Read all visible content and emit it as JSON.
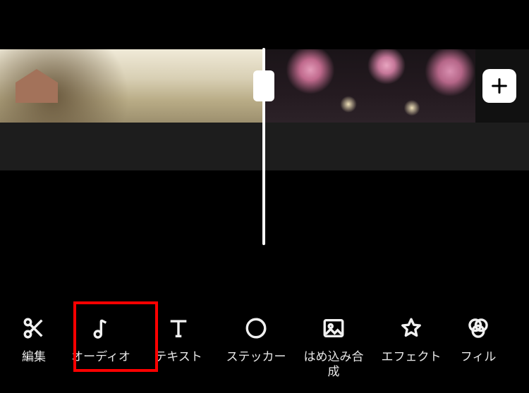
{
  "toolbar": {
    "items": [
      {
        "label": "編集"
      },
      {
        "label": "オーディオ"
      },
      {
        "label": "テキスト"
      },
      {
        "label": "ステッカー"
      },
      {
        "label": "はめ込み合\n成"
      },
      {
        "label": "エフェクト"
      },
      {
        "label": "フィル"
      }
    ]
  }
}
